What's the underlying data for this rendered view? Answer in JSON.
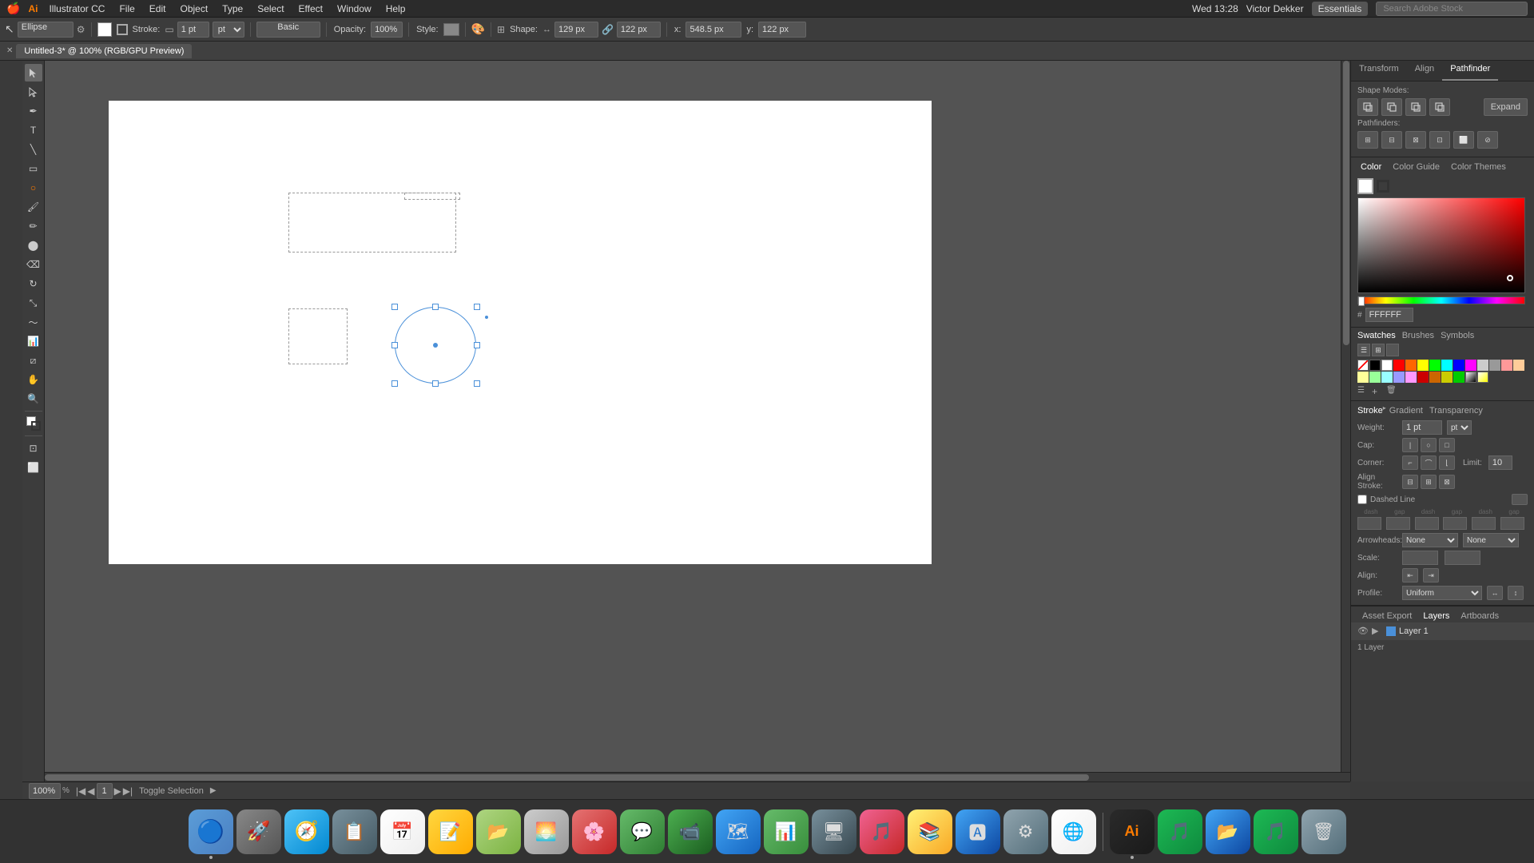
{
  "menubar": {
    "app_icon": "Ai",
    "items": [
      "Illustrator CC",
      "File",
      "Edit",
      "Object",
      "Type",
      "Select",
      "Effect",
      "Window",
      "Help"
    ],
    "time": "Wed 13:28",
    "user": "Victor Dekker",
    "essentials": "Essentials",
    "search_placeholder": "Search Adobe Stock"
  },
  "toolbar": {
    "shape_label": "Ellipse",
    "stroke_label": "Stroke:",
    "stroke_value": "1 pt",
    "opacity_label": "Opacity:",
    "opacity_value": "100%",
    "style_label": "Style:",
    "shape_w_label": "Shape:",
    "shape_w": "129 px",
    "shape_h": "122 px",
    "x_label": "x:",
    "x_value": "548.5 px",
    "y_label": "y:",
    "y_value": "122 px",
    "profile_label": "Basic"
  },
  "tabbar": {
    "title": "Untitled-3* @ 100% (RGB/GPU Preview)"
  },
  "pathfinder": {
    "tabs": [
      "Transform",
      "Align",
      "Pathfinder"
    ],
    "active_tab": "Pathfinder",
    "shape_modes_label": "Shape Modes:",
    "pathfinders_label": "Pathfinders:",
    "expand_label": "Expand"
  },
  "color_panel": {
    "tabs": [
      "Color",
      "Color Guide",
      "Color Themes"
    ],
    "active_tab": "Color",
    "hex_value": "FFFFFF"
  },
  "swatches": {
    "tabs": [
      "Swatches",
      "Brushes",
      "Symbols"
    ],
    "active_tab": "Swatches",
    "colors": [
      "#ffffff",
      "#000000",
      "#ff0000",
      "#ff6600",
      "#ffff00",
      "#00ff00",
      "#00ffff",
      "#0000ff",
      "#ff00ff",
      "#cccccc",
      "#999999",
      "#ff9999",
      "#ffcc99",
      "#ffff99",
      "#99ff99",
      "#99ffff",
      "#9999ff",
      "#ff99ff",
      "#ff3333",
      "#ff9933",
      "#ffff33",
      "#33ff33",
      "#33ffff",
      "#3333ff",
      "#cc0000",
      "#cc6600",
      "#cccc00",
      "#00cc00",
      "#00cccc",
      "#0000cc",
      "#660000",
      "#663300",
      "#666600",
      "#006600",
      "#006666",
      "#000066"
    ]
  },
  "stroke": {
    "tabs": [
      "Stroke",
      "Gradient",
      "Transparency"
    ],
    "active_tab": "Stroke",
    "weight_label": "Weight:",
    "weight_value": "1 pt",
    "cap_label": "Cap:",
    "corner_label": "Corner:",
    "limit_label": "Limit:",
    "limit_value": "10",
    "align_label": "Align Stroke:",
    "dashed_label": "Dashed Line",
    "dash_label": "dash",
    "gap_label": "gap",
    "arrowheads_label": "Arrowheads:",
    "scale_label": "Scale:",
    "align_row_label": "Align:",
    "profile_label": "Profile:"
  },
  "layers": {
    "tabs": [
      "Asset Export",
      "Layers",
      "Artboards"
    ],
    "active_tab": "Layers",
    "layer1_name": "Layer 1",
    "count": "1 Layer"
  },
  "statusbar": {
    "zoom": "100%",
    "page": "1",
    "toggle_label": "Toggle Selection"
  },
  "dock": {
    "items": [
      {
        "name": "Finder",
        "color": "#5b9dd8",
        "emoji": "🔵"
      },
      {
        "name": "Launchpad",
        "color": "#888",
        "emoji": "🚀"
      },
      {
        "name": "Safari",
        "color": "#888",
        "emoji": "🧭"
      },
      {
        "name": "App1",
        "color": "#888",
        "emoji": "📋"
      },
      {
        "name": "Calendar",
        "color": "#888",
        "emoji": "📅"
      },
      {
        "name": "Notes",
        "color": "#ffd700",
        "emoji": "📝"
      },
      {
        "name": "App2",
        "color": "#888",
        "emoji": "📁"
      },
      {
        "name": "App3",
        "color": "#888",
        "emoji": "🖼"
      },
      {
        "name": "App4",
        "color": "#888",
        "emoji": "🌅"
      },
      {
        "name": "Messages",
        "color": "#888",
        "emoji": "💬"
      },
      {
        "name": "FaceTime",
        "color": "#888",
        "emoji": "📹"
      },
      {
        "name": "App5",
        "color": "#888",
        "emoji": "🎭"
      },
      {
        "name": "Numbers",
        "color": "#888",
        "emoji": "📊"
      },
      {
        "name": "App6",
        "color": "#888",
        "emoji": "🖥"
      },
      {
        "name": "Music",
        "color": "#888",
        "emoji": "🎵"
      },
      {
        "name": "iBooks",
        "color": "#888",
        "emoji": "📚"
      },
      {
        "name": "AppStore",
        "color": "#888",
        "emoji": "🅰"
      },
      {
        "name": "SystemPrefs",
        "color": "#888",
        "emoji": "⚙"
      },
      {
        "name": "Chrome",
        "color": "#888",
        "emoji": "🌐"
      },
      {
        "name": "Illustrator",
        "color": "#ff7c00",
        "emoji": "Ai"
      },
      {
        "name": "Spotify",
        "color": "#1db954",
        "emoji": "🎧"
      },
      {
        "name": "Finder2",
        "color": "#888",
        "emoji": "📂"
      },
      {
        "name": "App7",
        "color": "#888",
        "emoji": "🎵"
      },
      {
        "name": "Trash",
        "color": "#888",
        "emoji": "🗑"
      }
    ]
  }
}
